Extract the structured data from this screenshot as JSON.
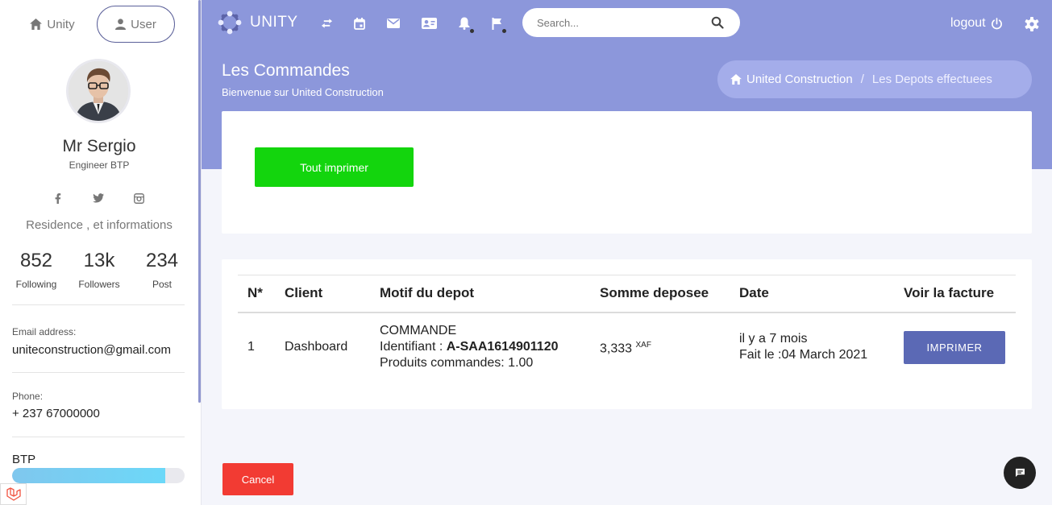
{
  "sidebar": {
    "tabs": [
      {
        "label": "Unity",
        "icon": "home-icon"
      },
      {
        "label": "User",
        "icon": "user-icon"
      }
    ],
    "profile": {
      "name": "Mr Sergio",
      "role": "Engineer BTP"
    },
    "socials": [
      "facebook-icon",
      "twitter-icon",
      "instagram-icon"
    ],
    "residence": "Residence , et informations",
    "stats": [
      {
        "value": "852",
        "label": "Following"
      },
      {
        "value": "13k",
        "label": "Followers"
      },
      {
        "value": "234",
        "label": "Post"
      }
    ],
    "email_label": "Email address:",
    "email": "uniteconstruction@gmail.com",
    "phone_label": "Phone:",
    "phone": "+ 237 67000000",
    "skill": {
      "label": "BTP",
      "progress": 0.89
    }
  },
  "topbar": {
    "brand": "UNITY",
    "icons": [
      "swap-icon",
      "calendar-icon",
      "mail-icon",
      "contact-card-icon",
      "bell-icon",
      "flag-icon"
    ],
    "search_placeholder": "Search...",
    "logout": "logout",
    "accent": "#8c97db"
  },
  "page": {
    "title": "Les Commandes",
    "subtitle": "Bienvenue sur United Construction",
    "breadcrumb": [
      "United Construction",
      "Les Depots effectuees"
    ]
  },
  "actions": {
    "print_all": "Tout imprimer",
    "cancel": "Cancel"
  },
  "table": {
    "headers": [
      "N*",
      "Client",
      "Motif du depot",
      "Somme deposee",
      "Date",
      "Voir la facture"
    ],
    "rows": [
      {
        "num": "1",
        "client": "Dashboard",
        "motif_type": "COMMANDE",
        "motif_id_label": "Identifiant : ",
        "motif_id": "A-SAA1614901120",
        "motif_products": "Produits commandes: 1.00",
        "amount": "3,333",
        "currency": "XAF",
        "date_relative": "il y a 7 mois",
        "date_full": "Fait le :04 March 2021",
        "action": "IMPRIMER"
      }
    ]
  }
}
